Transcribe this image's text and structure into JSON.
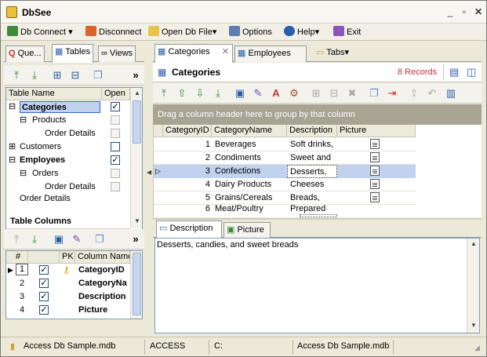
{
  "app": {
    "title": "DbSee"
  },
  "menu": {
    "db_connect": "Db Connect",
    "disconnect": "Disconnect",
    "open_db_file": "Open Db File",
    "options": "Options",
    "help": "Help",
    "exit": "Exit"
  },
  "left_tabs": {
    "queries": "Que...",
    "tables": "Tables",
    "views": "Views"
  },
  "tables_grid": {
    "headers": {
      "name": "Table Name",
      "open": "Open"
    },
    "rows": [
      {
        "label": "Categories",
        "checked": true
      },
      {
        "label": "Products",
        "checked": false
      },
      {
        "label": "Order Details",
        "checked": false
      },
      {
        "label": "Customers",
        "checked": false
      },
      {
        "label": "Employees",
        "checked": true
      },
      {
        "label": "Orders",
        "checked": false
      },
      {
        "label": "Order Details",
        "checked": false
      },
      {
        "label": "Order Details",
        "checked": false
      }
    ]
  },
  "table_columns": {
    "title": "Table Columns",
    "headers": {
      "num": "#",
      "pk": "PK",
      "name": "Column Name"
    },
    "rows": [
      {
        "num": "1",
        "name": "CategoryID"
      },
      {
        "num": "2",
        "name": "CategoryNa"
      },
      {
        "num": "3",
        "name": "Description"
      },
      {
        "num": "4",
        "name": "Picture"
      }
    ]
  },
  "right_tabs": {
    "categories": "Categories",
    "employees": "Employees",
    "tabs": "Tabs"
  },
  "content": {
    "title": "Categories",
    "records": "8 Records",
    "group_hint": "Drag a column header here to group by that column",
    "headers": [
      "CategoryID",
      "CategoryName",
      "Description",
      "Picture"
    ],
    "rows": [
      {
        "id": "1",
        "name": "Beverages",
        "desc": "Soft drinks,"
      },
      {
        "id": "2",
        "name": "Condiments",
        "desc": "Sweet and"
      },
      {
        "id": "3",
        "name": "Confections",
        "desc": "Desserts,"
      },
      {
        "id": "4",
        "name": "Dairy Products",
        "desc": "Cheeses"
      },
      {
        "id": "5",
        "name": "Grains/Cereals",
        "desc": "Breads,"
      },
      {
        "id": "6",
        "name": "Meat/Poultry",
        "desc": "Prepared"
      }
    ]
  },
  "detail_tabs": {
    "description": "Description",
    "picture": "Picture"
  },
  "detail_text": "Desserts, candies, and sweet breads",
  "status": {
    "file": "Access Db Sample.mdb",
    "type": "ACCESS",
    "drive": "C:",
    "file2": "Access Db Sample.mdb"
  },
  "colors": {
    "accent_blue": "#316ac5",
    "selected_row": "#c1d2ee",
    "title_text": "#000000"
  }
}
